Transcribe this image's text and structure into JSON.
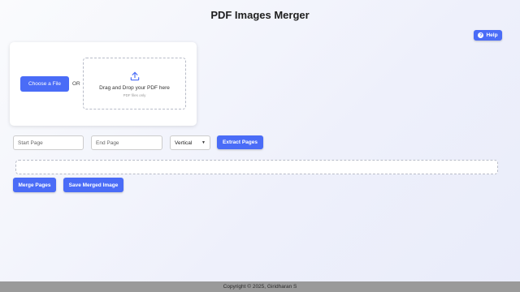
{
  "header": {
    "title": "PDF Images Merger"
  },
  "help": {
    "label": "Help",
    "icon": "question-icon"
  },
  "upload": {
    "choose_label": "Choose a File",
    "or_label": "OR",
    "drop_text": "Drag and Drop your PDF here",
    "drop_sub": "PDF files only",
    "upload_icon": "upload-icon"
  },
  "controls": {
    "start_placeholder": "Start Page",
    "end_placeholder": "End Page",
    "orientation_value": "Vertical",
    "extract_label": "Extract Pages"
  },
  "actions": {
    "merge_label": "Merge Pages",
    "save_label": "Save Merged Image"
  },
  "footer": {
    "text": "Copyright © 2025, Giridharan S"
  },
  "colors": {
    "accent": "#4a6cf7",
    "footer_bg": "#9a9a9a"
  }
}
